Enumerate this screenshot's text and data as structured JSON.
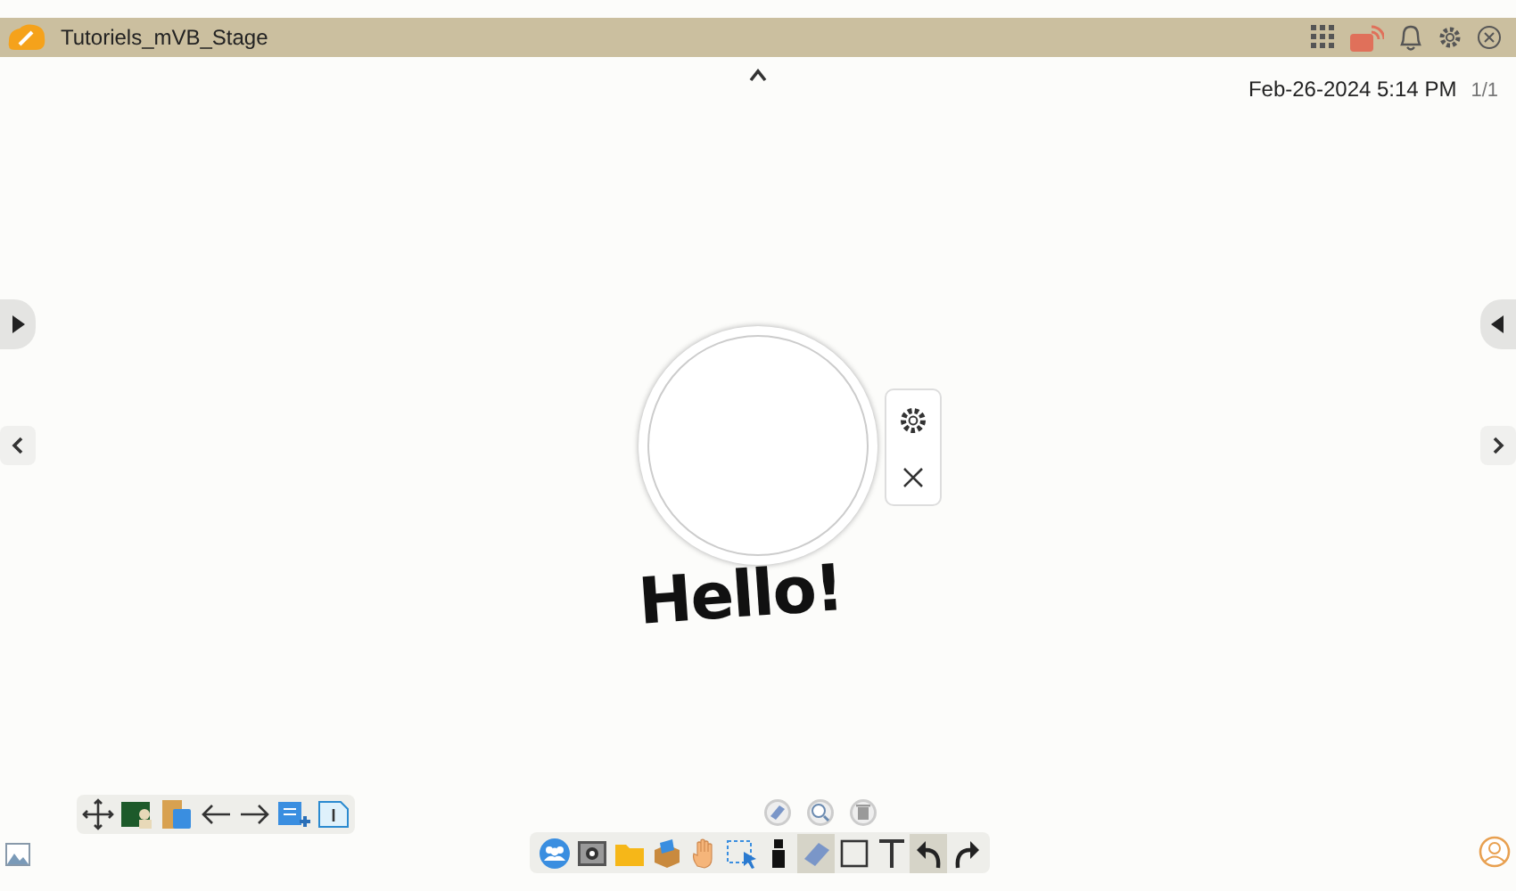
{
  "window": {
    "title": "Tutoriels_mVB_Stage"
  },
  "header": {
    "datetime": "Feb-26-2024 5:14 PM",
    "page_count": "1/1"
  },
  "canvas": {
    "handwriting": "Hello!"
  },
  "tools": [
    {
      "kind": "people",
      "selected": false
    },
    {
      "kind": "camera",
      "selected": false
    },
    {
      "kind": "folder",
      "selected": false
    },
    {
      "kind": "box",
      "selected": false
    },
    {
      "kind": "hand",
      "selected": false
    },
    {
      "kind": "select",
      "selected": false
    },
    {
      "kind": "marker",
      "selected": false
    },
    {
      "kind": "eraser",
      "selected": true
    },
    {
      "kind": "shape",
      "selected": false
    },
    {
      "kind": "text",
      "selected": false
    },
    {
      "kind": "undo",
      "selected": true
    },
    {
      "kind": "redo",
      "selected": false
    }
  ]
}
